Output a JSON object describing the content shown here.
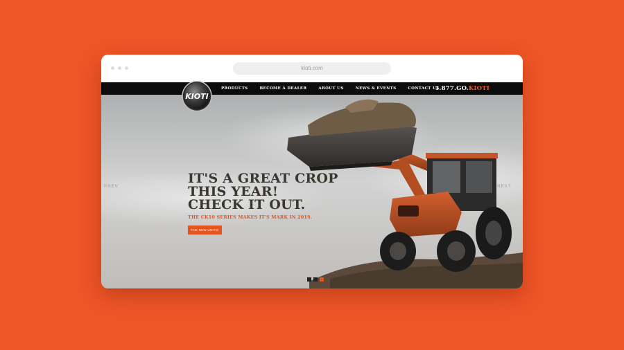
{
  "browser": {
    "url": "kioti.com"
  },
  "site": {
    "logo_text": "KIOTI",
    "nav": [
      {
        "label": "PRODUCTS"
      },
      {
        "label": "BECOME A DEALER"
      },
      {
        "label": "ABOUT US"
      },
      {
        "label": "NEWS & EVENTS"
      },
      {
        "label": "CONTACT US"
      }
    ],
    "phone_prefix": "1.877.GO.",
    "phone_suffix": "KIOTI"
  },
  "hero": {
    "headline": [
      "IT'S A GREAT CROP",
      "THIS YEAR!",
      "CHECK IT OUT."
    ],
    "subheadline": "THE CK10 SERIES MAKES IT'S MARK IN 2019.",
    "cta_label": "THE NEW UNITS!",
    "prev_label": "PREV",
    "next_label": "NEXT",
    "slide_count": 3,
    "active_slide": 3
  },
  "colors": {
    "page_background": "#EE5527",
    "brand_orange": "#E5531F",
    "nav_background": "#0c0c0c",
    "headline_text": "#3a3731"
  }
}
